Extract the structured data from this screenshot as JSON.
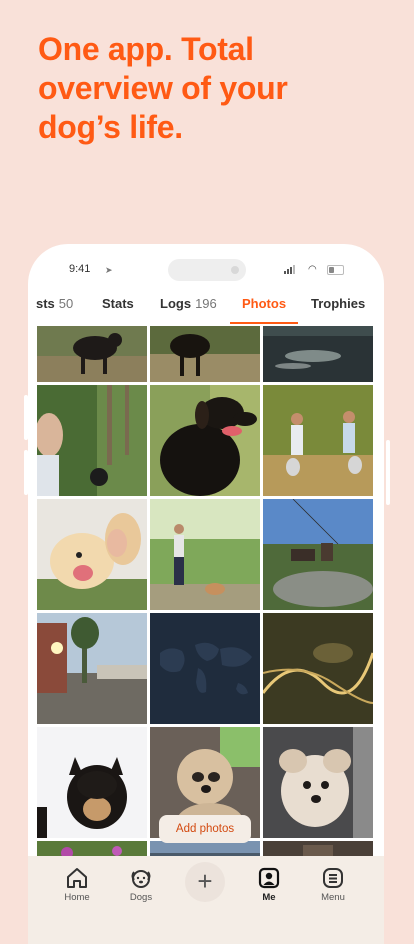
{
  "headline": "One app. Total overview of your dog’s life.",
  "status_bar": {
    "time": "9:41"
  },
  "tabs": [
    {
      "label": "sts",
      "count": "50"
    },
    {
      "label": "Stats",
      "count": ""
    },
    {
      "label": "Logs",
      "count": "196"
    },
    {
      "label": "Photos",
      "count": ""
    },
    {
      "label": "Trophies",
      "count": ""
    }
  ],
  "active_tab": "Photos",
  "add_photos_label": "Add photos",
  "nav": [
    {
      "label": "Home",
      "icon": "house-icon"
    },
    {
      "label": "Dogs",
      "icon": "dog-face-icon"
    },
    {
      "label": "",
      "icon": "plus-icon"
    },
    {
      "label": "Me",
      "icon": "person-icon"
    },
    {
      "label": "Menu",
      "icon": "menu-icon"
    }
  ],
  "colors": {
    "accent": "#ff5a14",
    "background": "#f9e1d9",
    "nav_bg": "#f4ede6"
  }
}
